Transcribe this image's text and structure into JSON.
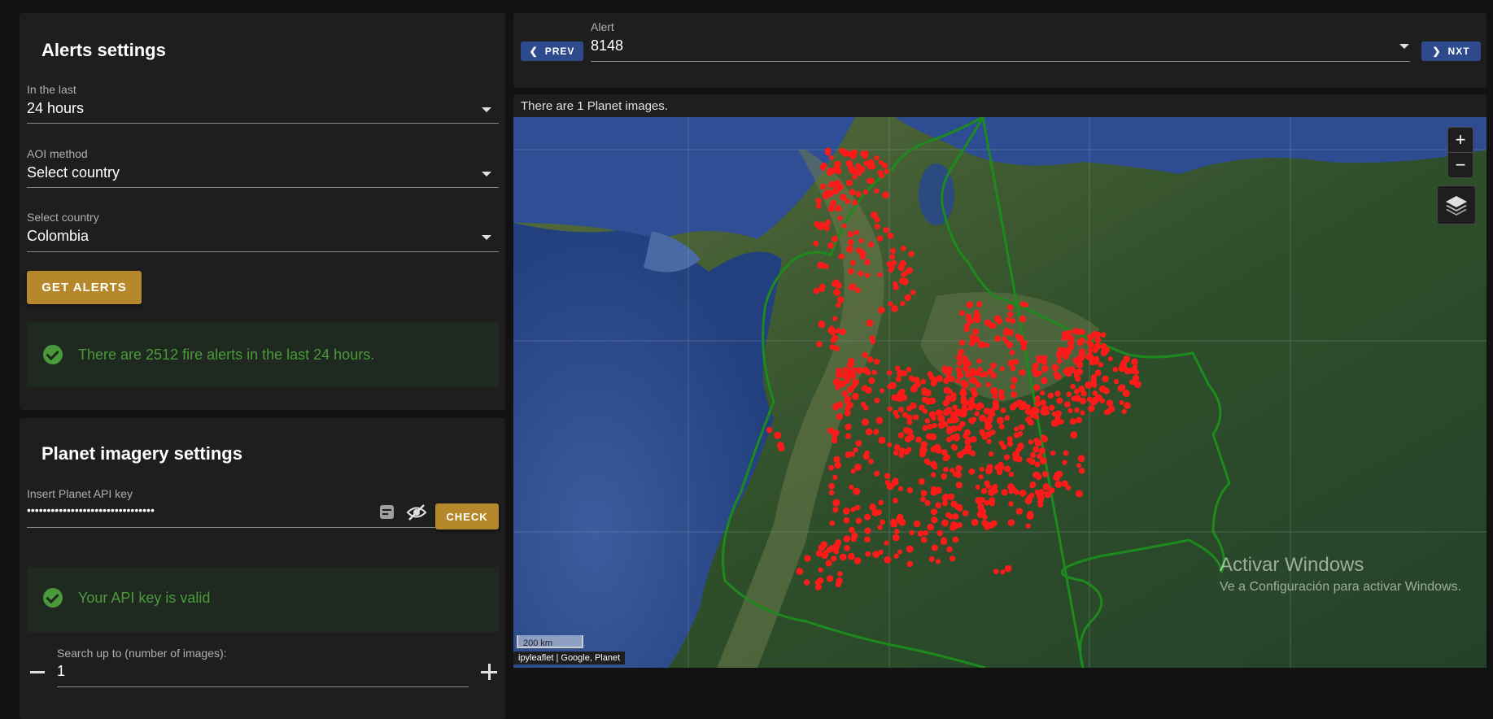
{
  "alerts_settings": {
    "title": "Alerts settings",
    "in_the_last": {
      "label": "In the last",
      "value": "24 hours"
    },
    "aoi_method": {
      "label": "AOI method",
      "value": "Select country"
    },
    "select_country": {
      "label": "Select country",
      "value": "Colombia"
    },
    "get_alerts_label": "GET ALERTS",
    "status_message": "There are 2512 fire alerts in the last 24 hours."
  },
  "planet_settings": {
    "title": "Planet imagery settings",
    "api_key": {
      "label": "Insert Planet API key",
      "value": "••••••••••••••••••••••••••••••••"
    },
    "check_label": "CHECK",
    "status_message": "Your API key is valid",
    "search_up_to": {
      "label": "Search up to (number of images):",
      "value": "1"
    }
  },
  "alert_nav": {
    "prev_label": "PREV",
    "next_label": "NXT",
    "alert_label": "Alert",
    "alert_value": "8148"
  },
  "map": {
    "info_text": "There are 1 Planet images.",
    "zoom_in": "+",
    "zoom_out": "−",
    "scale_label": "200 km",
    "attribution": "ipyleaflet | Google, Planet"
  },
  "watermark": {
    "line1": "Activar Windows",
    "line2": "Ve a Configuración para activar Windows."
  },
  "colors": {
    "accent_gold": "#b5892b",
    "nav_blue": "#2e4a8c",
    "success_green": "#4a9a3c",
    "fire_red": "#ff1a1a",
    "country_border": "#1e8a1e"
  }
}
